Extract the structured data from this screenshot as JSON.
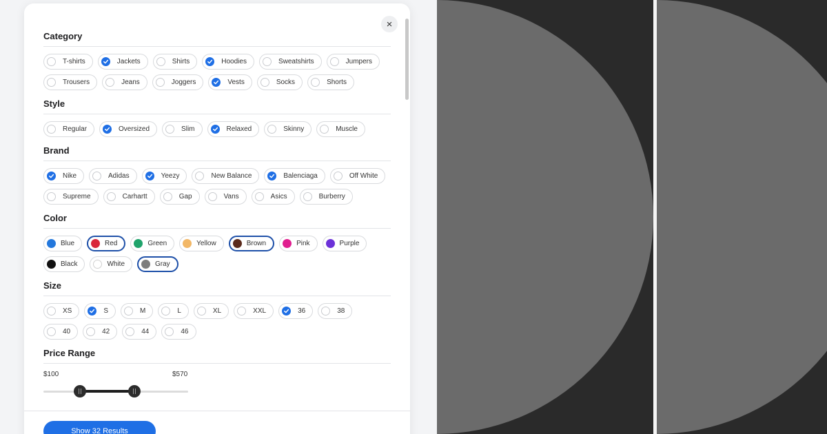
{
  "close_label": "×",
  "sections": {
    "category": {
      "title": "Category",
      "rows": [
        [
          {
            "label": "T-shirts",
            "checked": false
          },
          {
            "label": "Jackets",
            "checked": true
          },
          {
            "label": "Shirts",
            "checked": false
          },
          {
            "label": "Hoodies",
            "checked": true
          },
          {
            "label": "Sweatshirts",
            "checked": false
          },
          {
            "label": "Jumpers",
            "checked": false
          }
        ],
        [
          {
            "label": "Trousers",
            "checked": false
          },
          {
            "label": "Jeans",
            "checked": false
          },
          {
            "label": "Joggers",
            "checked": false
          },
          {
            "label": "Vests",
            "checked": true
          },
          {
            "label": "Socks",
            "checked": false
          },
          {
            "label": "Shorts",
            "checked": false
          }
        ]
      ]
    },
    "style": {
      "title": "Style",
      "rows": [
        [
          {
            "label": "Regular",
            "checked": false
          },
          {
            "label": "Oversized",
            "checked": true
          },
          {
            "label": "Slim",
            "checked": false
          },
          {
            "label": "Relaxed",
            "checked": true
          },
          {
            "label": "Skinny",
            "checked": false
          },
          {
            "label": "Muscle",
            "checked": false
          }
        ]
      ]
    },
    "brand": {
      "title": "Brand",
      "rows": [
        [
          {
            "label": "Nike",
            "checked": true
          },
          {
            "label": "Adidas",
            "checked": false
          },
          {
            "label": "Yeezy",
            "checked": true
          },
          {
            "label": "New Balance",
            "checked": false
          },
          {
            "label": "Balenciaga",
            "checked": true
          },
          {
            "label": "Off White",
            "checked": false
          }
        ],
        [
          {
            "label": "Supreme",
            "checked": false
          },
          {
            "label": "Carhartt",
            "checked": false
          },
          {
            "label": "Gap",
            "checked": false
          },
          {
            "label": "Vans",
            "checked": false
          },
          {
            "label": "Asics",
            "checked": false
          },
          {
            "label": "Burberry",
            "checked": false
          }
        ]
      ]
    },
    "color": {
      "title": "Color",
      "rows": [
        [
          {
            "label": "Blue",
            "swatch": "#2478dc",
            "selected": false
          },
          {
            "label": "Red",
            "swatch": "#d9263a",
            "selected": true
          },
          {
            "label": "Green",
            "swatch": "#1fa36b",
            "selected": false
          },
          {
            "label": "Yellow",
            "swatch": "#f2b766",
            "selected": false
          },
          {
            "label": "Brown",
            "swatch": "#5a2a1c",
            "selected": true
          },
          {
            "label": "Pink",
            "swatch": "#e01f8f",
            "selected": false
          },
          {
            "label": "Purple",
            "swatch": "#6c31d8",
            "selected": false
          }
        ],
        [
          {
            "label": "Black",
            "swatch": "#111111",
            "selected": false
          },
          {
            "label": "White",
            "swatch": "#ffffff",
            "selected": false
          },
          {
            "label": "Gray",
            "swatch": "#7d7d7d",
            "selected": true
          }
        ]
      ]
    },
    "size": {
      "title": "Size",
      "rows": [
        [
          {
            "label": "XS",
            "checked": false
          },
          {
            "label": "S",
            "checked": true
          },
          {
            "label": "M",
            "checked": false
          },
          {
            "label": "L",
            "checked": false
          },
          {
            "label": "XL",
            "checked": false
          },
          {
            "label": "XXL",
            "checked": false
          }
        ],
        [
          {
            "label": "36",
            "checked": true
          },
          {
            "label": "38",
            "checked": false
          },
          {
            "label": "40",
            "checked": false
          },
          {
            "label": "42",
            "checked": false
          },
          {
            "label": "44",
            "checked": false
          },
          {
            "label": "46",
            "checked": false
          }
        ]
      ]
    },
    "price": {
      "title": "Price Range",
      "min_label": "$100",
      "max_label": "$570",
      "range_min": 0,
      "range_max": 1000,
      "value_min": 250,
      "value_max": 630
    }
  },
  "footer": {
    "button_label": "Show 32 Results"
  },
  "theme": {
    "accent": "#1f6fe5",
    "selected_border": "#1d4fa8"
  }
}
